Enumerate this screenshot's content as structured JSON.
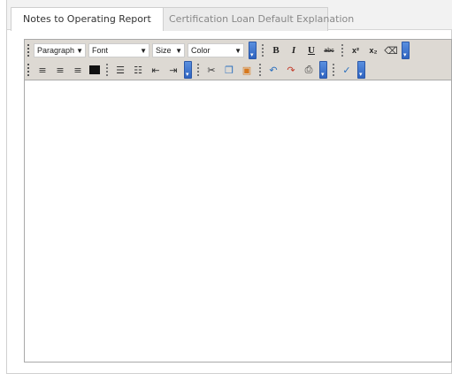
{
  "tabs": [
    {
      "label": "Notes to Operating Report",
      "active": true
    },
    {
      "label": "Certification Loan Default Explanation",
      "active": false
    }
  ],
  "toolbar": {
    "paragraph": "Paragraph",
    "font": "Font",
    "size": "Size",
    "color": "Color",
    "bold": "B",
    "italic": "I",
    "underline": "U",
    "strike": "abc",
    "superscript": "x²",
    "subscript": "x₂"
  },
  "editor": {
    "content": ""
  },
  "colors": {
    "toolbar_bg": "#ddd9d3",
    "more_button": "#2e63c0"
  }
}
